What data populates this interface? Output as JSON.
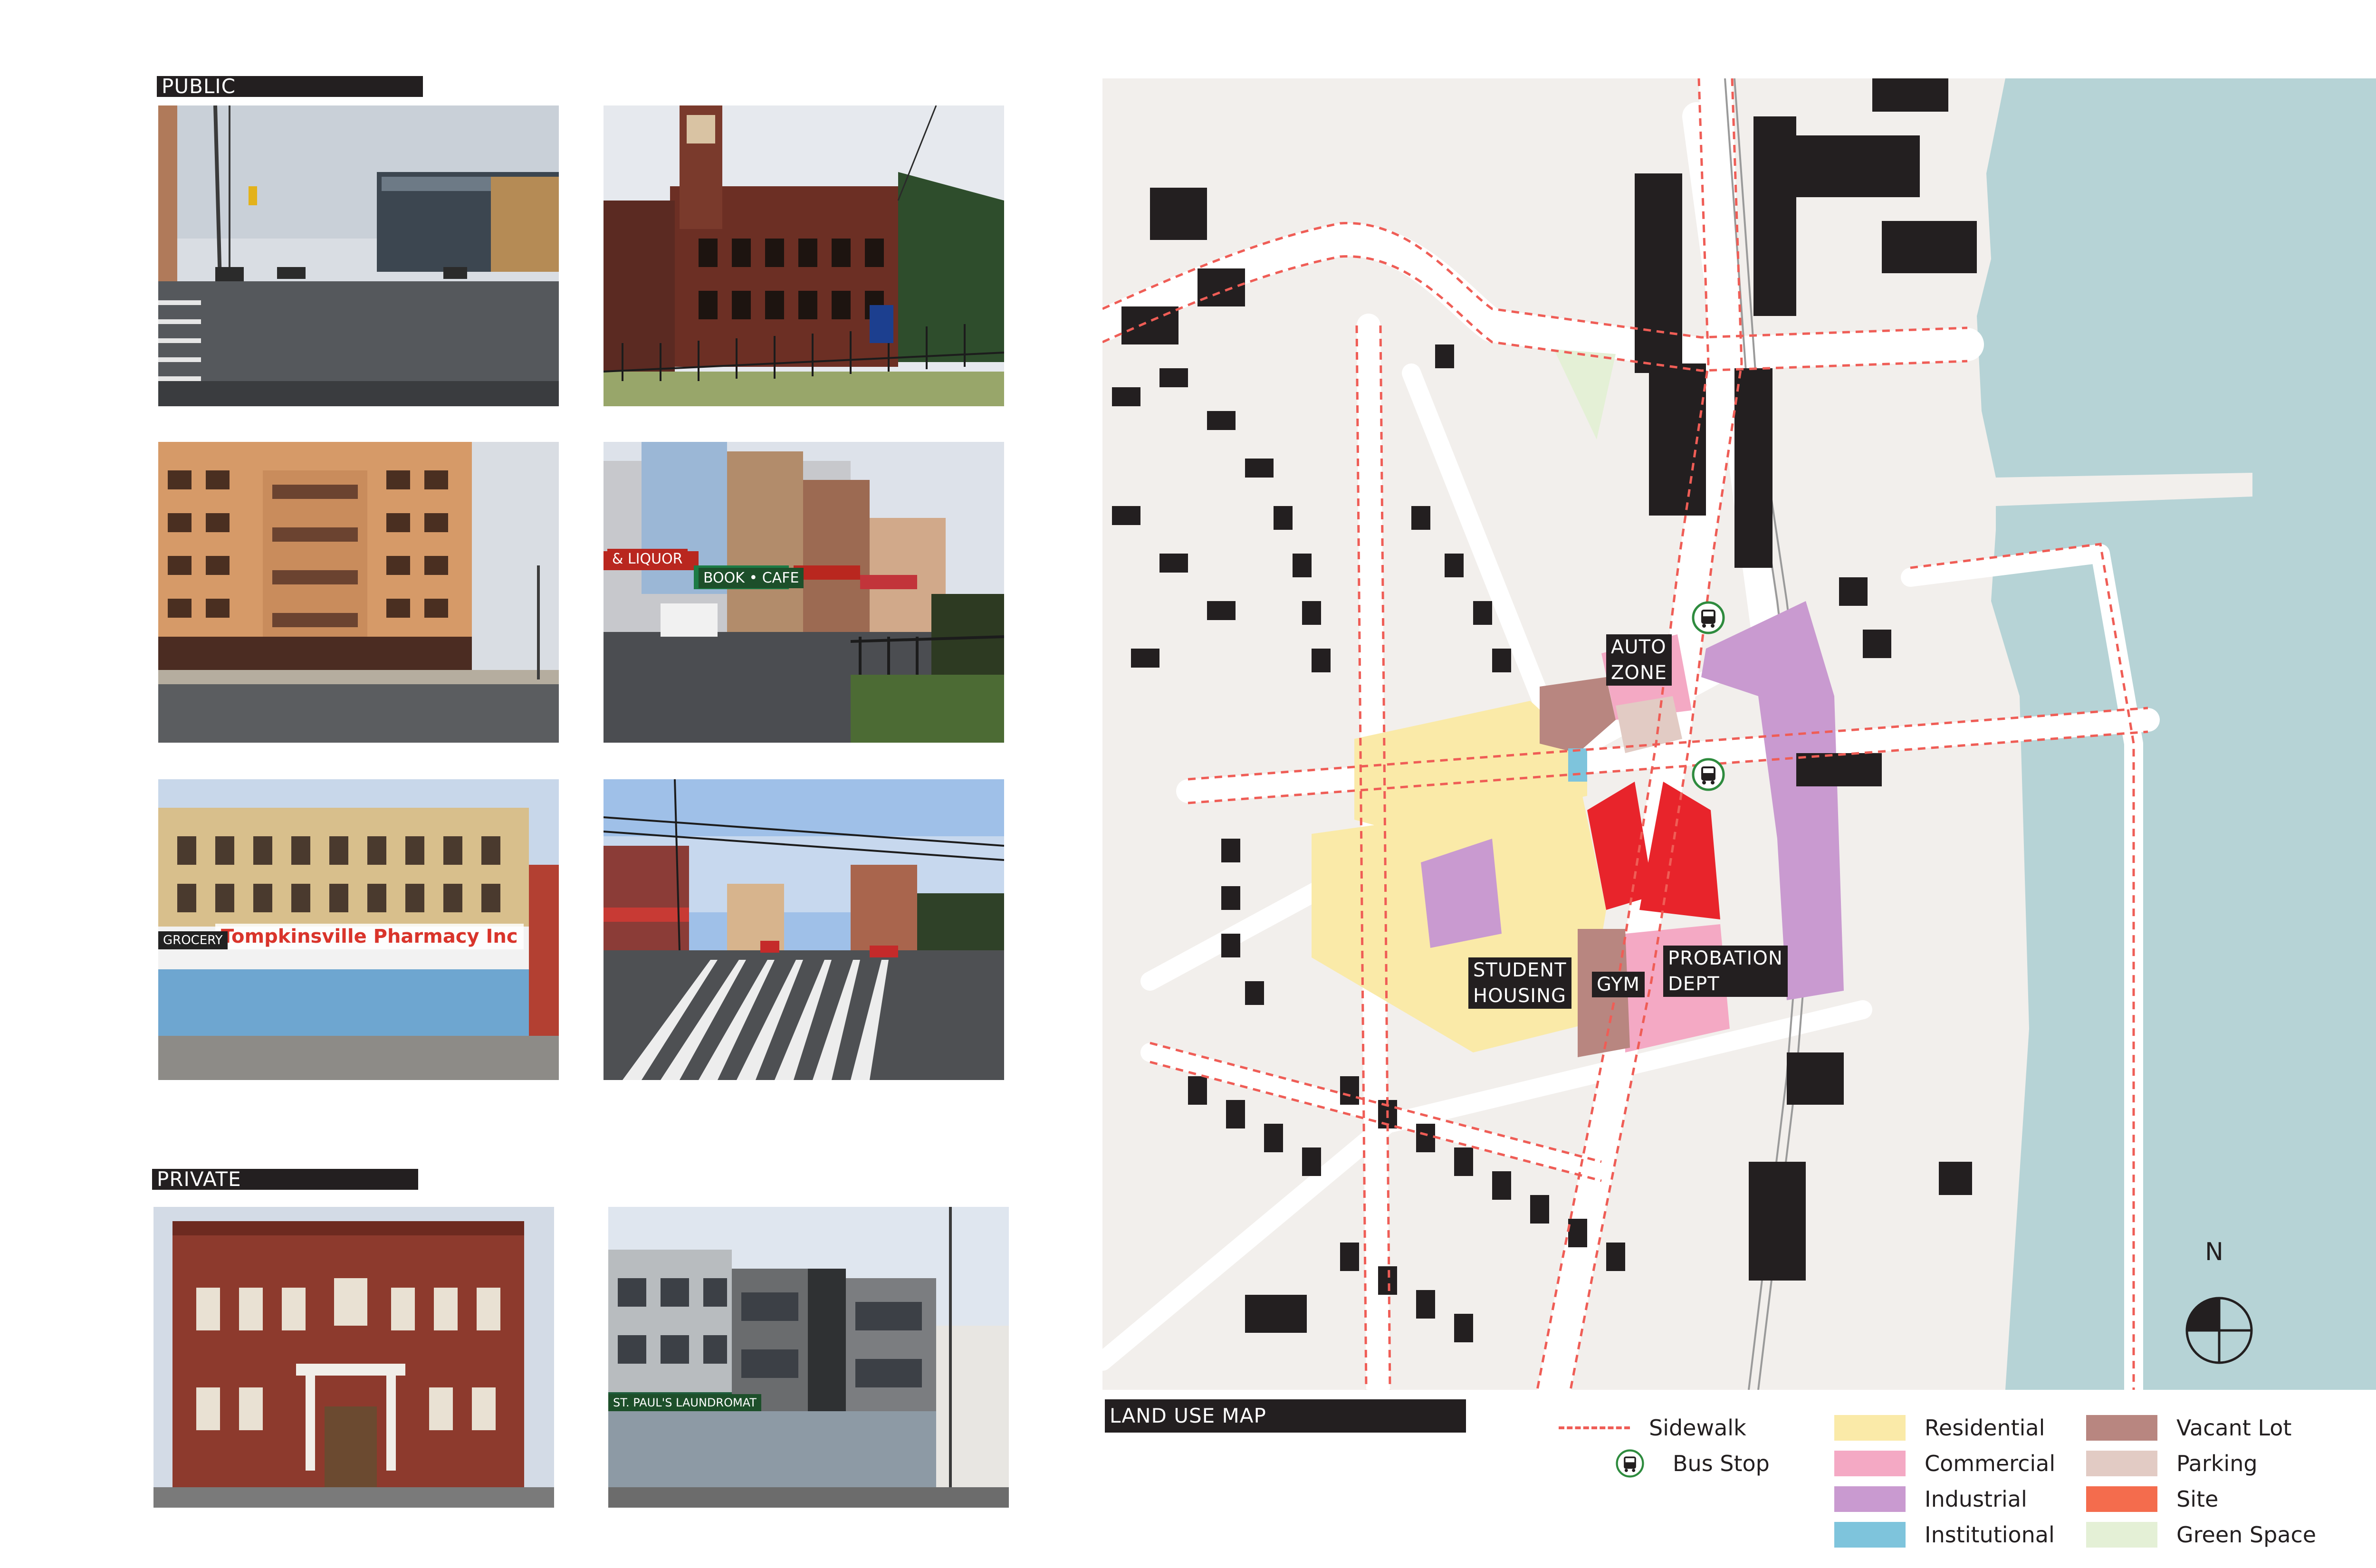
{
  "sections": {
    "public": "PUBLIC",
    "private": "PRIVATE",
    "map": "LAND USE MAP"
  },
  "photos": {
    "pharmacy_sign": "Tompkinsville Pharmacy Inc",
    "grocery_sign": "GROCERY",
    "liquor_sign": "& LIQUOR",
    "bookcafe_sign": "BOOK • CAFE",
    "laundromat_sign": "ST. PAUL'S LAUNDROMAT"
  },
  "map": {
    "labels": {
      "auto_zone": "AUTO\nZONE",
      "student_housing": "STUDENT\nHOUSING",
      "gym": "GYM",
      "probation": "PROBATION\nDEPT"
    },
    "north": "N"
  },
  "legend": {
    "sidewalk": "Sidewalk",
    "bus_stop": "Bus Stop",
    "residential": "Residential",
    "commercial": "Commercial",
    "industrial": "Industrial",
    "institutional": "Institutional",
    "vacant_lot": "Vacant Lot",
    "parking": "Parking",
    "site": "Site",
    "green_space": "Green Space"
  },
  "colors": {
    "residential": "#faeaa8",
    "commercial": "#f4a9c4",
    "industrial": "#c99ad0",
    "institutional": "#7ec4dc",
    "vacant_lot": "#b88680",
    "parking": "#e2cbc4",
    "site": "#f46c4d",
    "green_space": "#e4f0d6",
    "sidewalk": "#ef5d56",
    "water": "#b6d3d6",
    "building": "#231f20"
  },
  "icons": {
    "bus_stop": "bus-stop-icon",
    "north_arrow": "north-arrow-icon"
  }
}
